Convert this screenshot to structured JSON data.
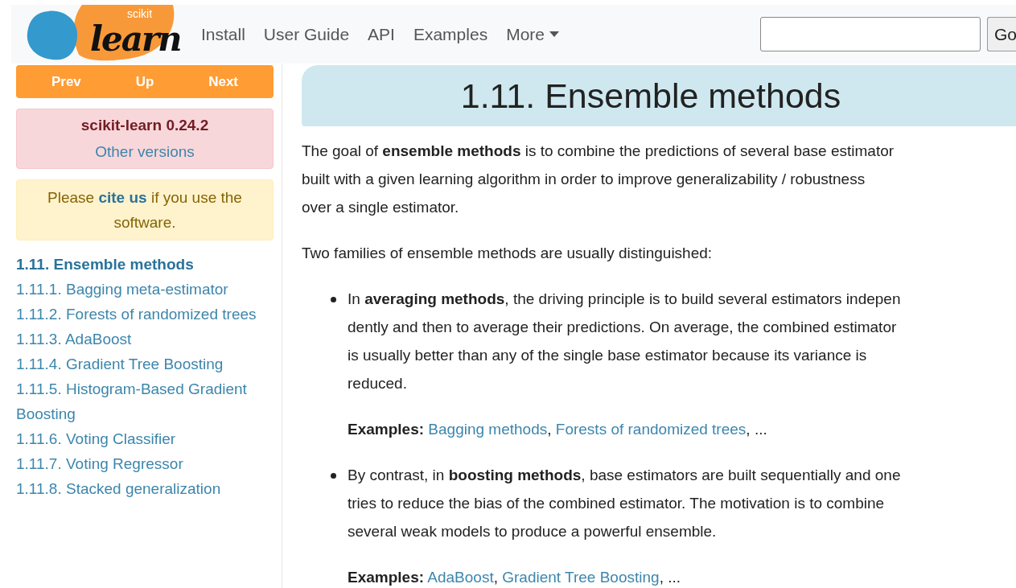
{
  "navbar": {
    "logo": {
      "small": "scikit",
      "big": "learn"
    },
    "links": [
      {
        "label": "Install"
      },
      {
        "label": "User Guide"
      },
      {
        "label": "API"
      },
      {
        "label": "Examples"
      }
    ],
    "more": {
      "label": "More",
      "expanded": false
    },
    "go_button": "Go"
  },
  "sidebar": {
    "pager": [
      "Prev",
      "Up",
      "Next"
    ],
    "version": {
      "title": "scikit-learn 0.24.2",
      "link": "Other versions"
    },
    "cite": {
      "before": "Please ",
      "link": "cite us",
      "after": " if you use the software."
    },
    "toc": [
      {
        "label": "1.11. Ensemble methods",
        "selected": true,
        "children": [
          {
            "label": "1.11.1. Bagging meta-estimator",
            "selected": false
          },
          {
            "label": "1.11.2. Forests of randomized trees",
            "selected": false
          },
          {
            "label": "1.11.3. AdaBoost",
            "selected": false
          },
          {
            "label": "1.11.4. Gradient Tree Boosting",
            "selected": false
          },
          {
            "label": "1.11.5. Histogram-Based Gradient Boosting",
            "selected": false
          },
          {
            "label": "1.11.6. Voting Classifier",
            "selected": false
          },
          {
            "label": "1.11.7. Voting Regressor",
            "selected": false
          },
          {
            "label": "1.11.8. Stacked generalization",
            "selected": false
          }
        ]
      }
    ]
  },
  "main": {
    "title": "1.11. Ensemble methods",
    "paragraphs": [
      {
        "lines": [
          "The goal of **ensemble methods** is to combine the predictions of several base estimator",
          "built with a given learning algorithm in order to improve generalizability / robustness",
          "over a single estimator."
        ]
      },
      {
        "lines": [
          "Two families of ensemble methods are usually distinguished:"
        ]
      }
    ],
    "bullets": [
      {
        "lines": [
          "In **averaging methods**, the driving principle is to build several estimators indepen",
          "dently and then to average their predictions. On average, the combined estimator",
          "is usually better than any of the single base estimator because its variance is",
          "reduced."
        ],
        "examples": {
          "label": "Examples:",
          "links": [
            "Bagging methods",
            "Forests of randomized trees"
          ],
          "separator": ",",
          "trailing": "..."
        }
      },
      {
        "lines": [
          "By contrast, in **boosting methods**, base estimators are built sequentially and one",
          "tries to reduce the bias of the combined estimator. The motivation is to combine",
          "several weak models to produce a powerful ensemble."
        ],
        "examples": {
          "label": "Examples:",
          "links": [
            "AdaBoost",
            "Gradient Tree Boosting"
          ],
          "separator": ",",
          "trailing": "..."
        }
      }
    ]
  }
}
